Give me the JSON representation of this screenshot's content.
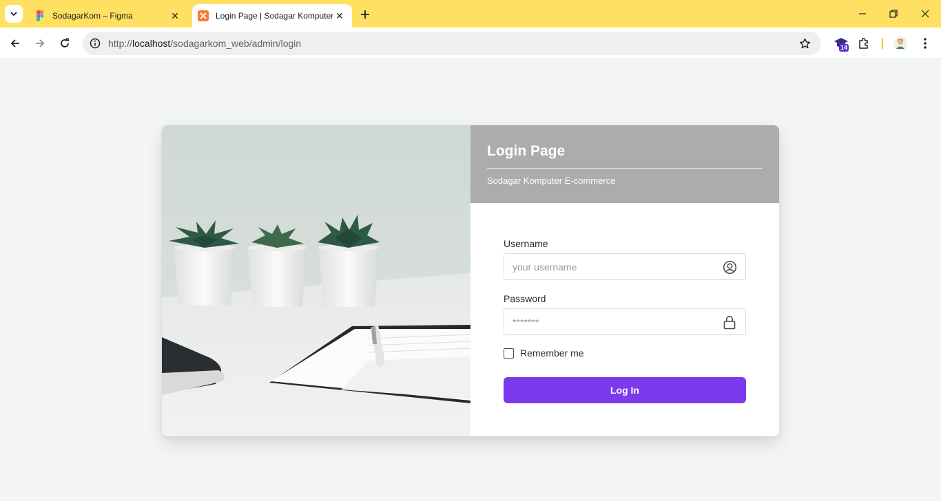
{
  "browser": {
    "tabs": [
      {
        "title": "SodagarKom – Figma",
        "favicon": "figma-icon",
        "active": false
      },
      {
        "title": "Login Page | Sodagar Komputer",
        "favicon": "xampp-icon",
        "active": true
      }
    ],
    "url": {
      "scheme": "http://",
      "host": "localhost",
      "path": "/sodagarkom_web/admin/login"
    },
    "extension_badge": "14"
  },
  "login": {
    "title": "Login Page",
    "subtitle": "Sodagar Komputer E-commerce",
    "username": {
      "label": "Username",
      "placeholder": "your username",
      "icon": "user-circle-icon"
    },
    "password": {
      "label": "Password",
      "placeholder": "*******",
      "icon": "lock-icon"
    },
    "remember_label": "Remember me",
    "remember_checked": false,
    "submit_label": "Log In"
  },
  "colors": {
    "tabbar": "#ffe062",
    "header": "#acacac",
    "accent": "#7c3aed",
    "page_bg": "#f3f4f6"
  }
}
